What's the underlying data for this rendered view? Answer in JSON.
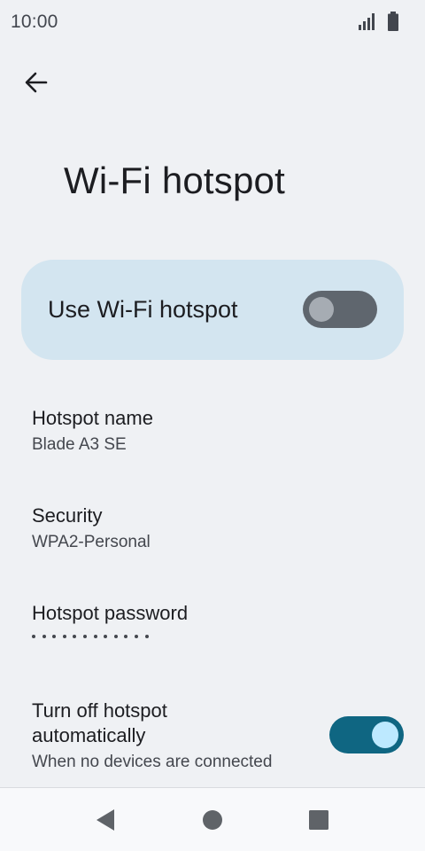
{
  "status_bar": {
    "time": "10:00",
    "icons": [
      "signal-icon",
      "battery-icon"
    ]
  },
  "app_bar": {
    "back_icon": "arrow-back-icon",
    "title": "Wi-Fi hotspot"
  },
  "main_switch": {
    "label": "Use Wi-Fi hotspot",
    "checked": false
  },
  "preferences": [
    {
      "title": "Hotspot name",
      "summary": "Blade A3 SE"
    },
    {
      "title": "Security",
      "summary": "WPA2-Personal"
    },
    {
      "title": "Hotspot password",
      "summary_masked_length": 12
    },
    {
      "title_line1": "Turn off hotspot",
      "title_line2": "automatically",
      "summary": "When no devices are connected",
      "checked": true
    }
  ],
  "nav_bar": {
    "items": [
      "back-triangle-icon",
      "home-circle-icon",
      "recents-square-icon"
    ]
  },
  "colors": {
    "background": "#eff1f4",
    "card": "#d3e5f0",
    "toggle_on_track": "#0f6682",
    "toggle_on_thumb": "#bde9ff",
    "toggle_off_track": "#5f666e",
    "toggle_off_thumb": "#a6acb3"
  }
}
